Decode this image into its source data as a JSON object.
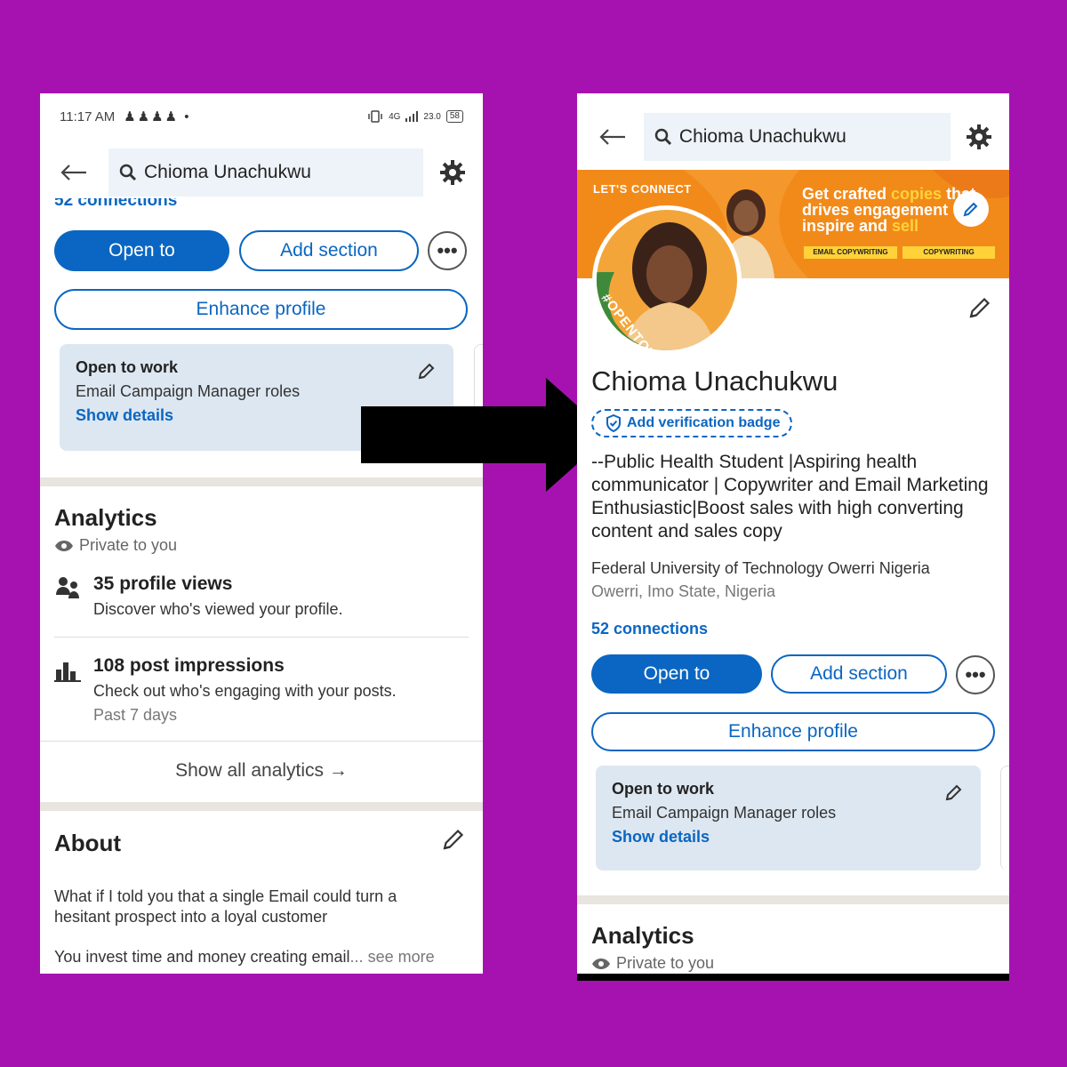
{
  "left": {
    "status": {
      "time": "11:17 AM",
      "icons": "♟♟♟♟ •",
      "network": "4G",
      "speed": "23.0",
      "battery": "58"
    },
    "search": {
      "query": "Chioma Unachukwu"
    },
    "scrolled_text": "52 connections",
    "actions": {
      "open_to": "Open to",
      "add_section": "Add section",
      "more": "•••",
      "enhance": "Enhance profile"
    },
    "open_to_work": {
      "title": "Open to work",
      "role": "Email Campaign Manager roles",
      "link": "Show details"
    },
    "analytics": {
      "title": "Analytics",
      "private": "Private to you",
      "stats": [
        {
          "headline": "35 profile views",
          "desc": "Discover who's viewed your profile.",
          "period": ""
        },
        {
          "headline": "108 post impressions",
          "desc": "Check out who's engaging with your posts.",
          "period": "Past 7 days"
        }
      ],
      "show_all": "Show all analytics →"
    },
    "about": {
      "title": "About",
      "p1": "What if I told you that a single Email could turn a hesitant prospect into a loyal customer",
      "p2": "You invest time and money  creating email",
      "ellipsis": "...",
      "see_more": "see more"
    }
  },
  "right": {
    "search": {
      "query": "Chioma Unachukwu"
    },
    "banner": {
      "lets_connect": "LET'S CONNECT",
      "line1a": "Get crafted ",
      "line1b": "copies",
      "line1c": " that",
      "line2": "drives engagement",
      "line3a": "inspire and ",
      "line3b": "sell",
      "tag1": "EMAIL COPYWRITING",
      "tag2": "COPYWRITING"
    },
    "badge_text": "#OPENTOWORK",
    "name": "Chioma Unachukwu",
    "verify": "Add verification badge",
    "headline": "--Public Health Student |Aspiring health communicator | Copywriter and Email Marketing Enthusiastic|Boost sales with high converting content and sales copy",
    "education": "Federal University of Technology Owerri Nigeria",
    "location": "Owerri, Imo State, Nigeria",
    "connections": "52 connections",
    "actions": {
      "open_to": "Open to",
      "add_section": "Add section",
      "more": "•••",
      "enhance": "Enhance profile"
    },
    "open_to_work": {
      "title": "Open to work",
      "role": "Email Campaign Manager roles",
      "link": "Show details"
    },
    "analytics": {
      "title": "Analytics",
      "private": "Private to you"
    }
  },
  "colors": {
    "background": "#a612b0",
    "linkedin_blue": "#0a66c2",
    "banner_orange": "#f28a1a",
    "highlight_yellow": "#ffd23a",
    "opentowork_green": "#3f8a3a"
  }
}
